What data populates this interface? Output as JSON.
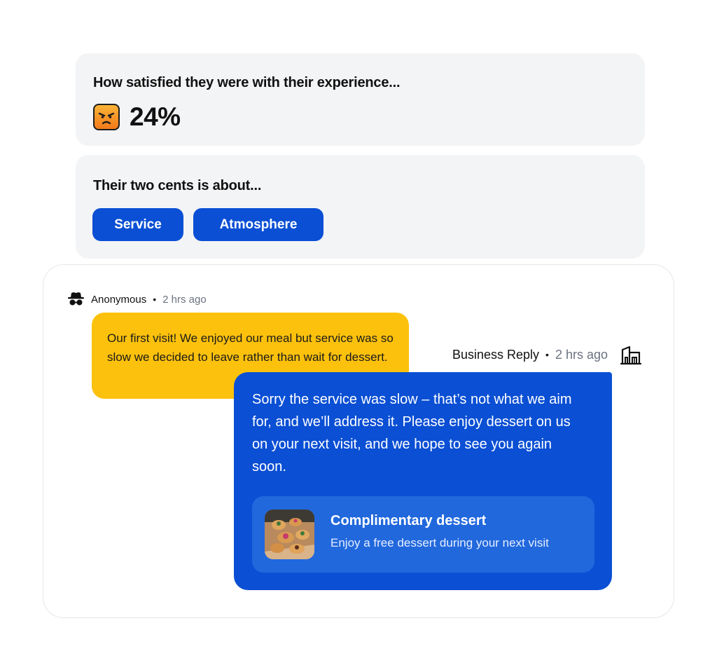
{
  "satisfaction": {
    "title": "How satisfied they were with their experience...",
    "score": "24%",
    "icon": "angry-face-icon"
  },
  "topics": {
    "title": "Their two cents is about...",
    "chips": [
      "Service",
      "Atmosphere"
    ]
  },
  "review": {
    "author": "Anonymous",
    "separator": "•",
    "time": "2 hrs ago",
    "text": "Our first visit! We enjoyed our meal but service was so slow we decided to leave rather than wait for dessert."
  },
  "reply": {
    "author": "Business Reply",
    "separator": "•",
    "time": "2 hrs ago",
    "text": "Sorry the service was slow – that’s not what we aim for, and we’ll address it. Please enjoy dessert on us on your next visit, and we hope to see you again soon.",
    "offer": {
      "title": "Complimentary dessert",
      "subtitle": "Enjoy a free dessert during your next visit"
    }
  },
  "colors": {
    "accent_blue": "#0a4fd4",
    "review_yellow": "#fcc10c",
    "card_gray": "#f3f4f6"
  }
}
